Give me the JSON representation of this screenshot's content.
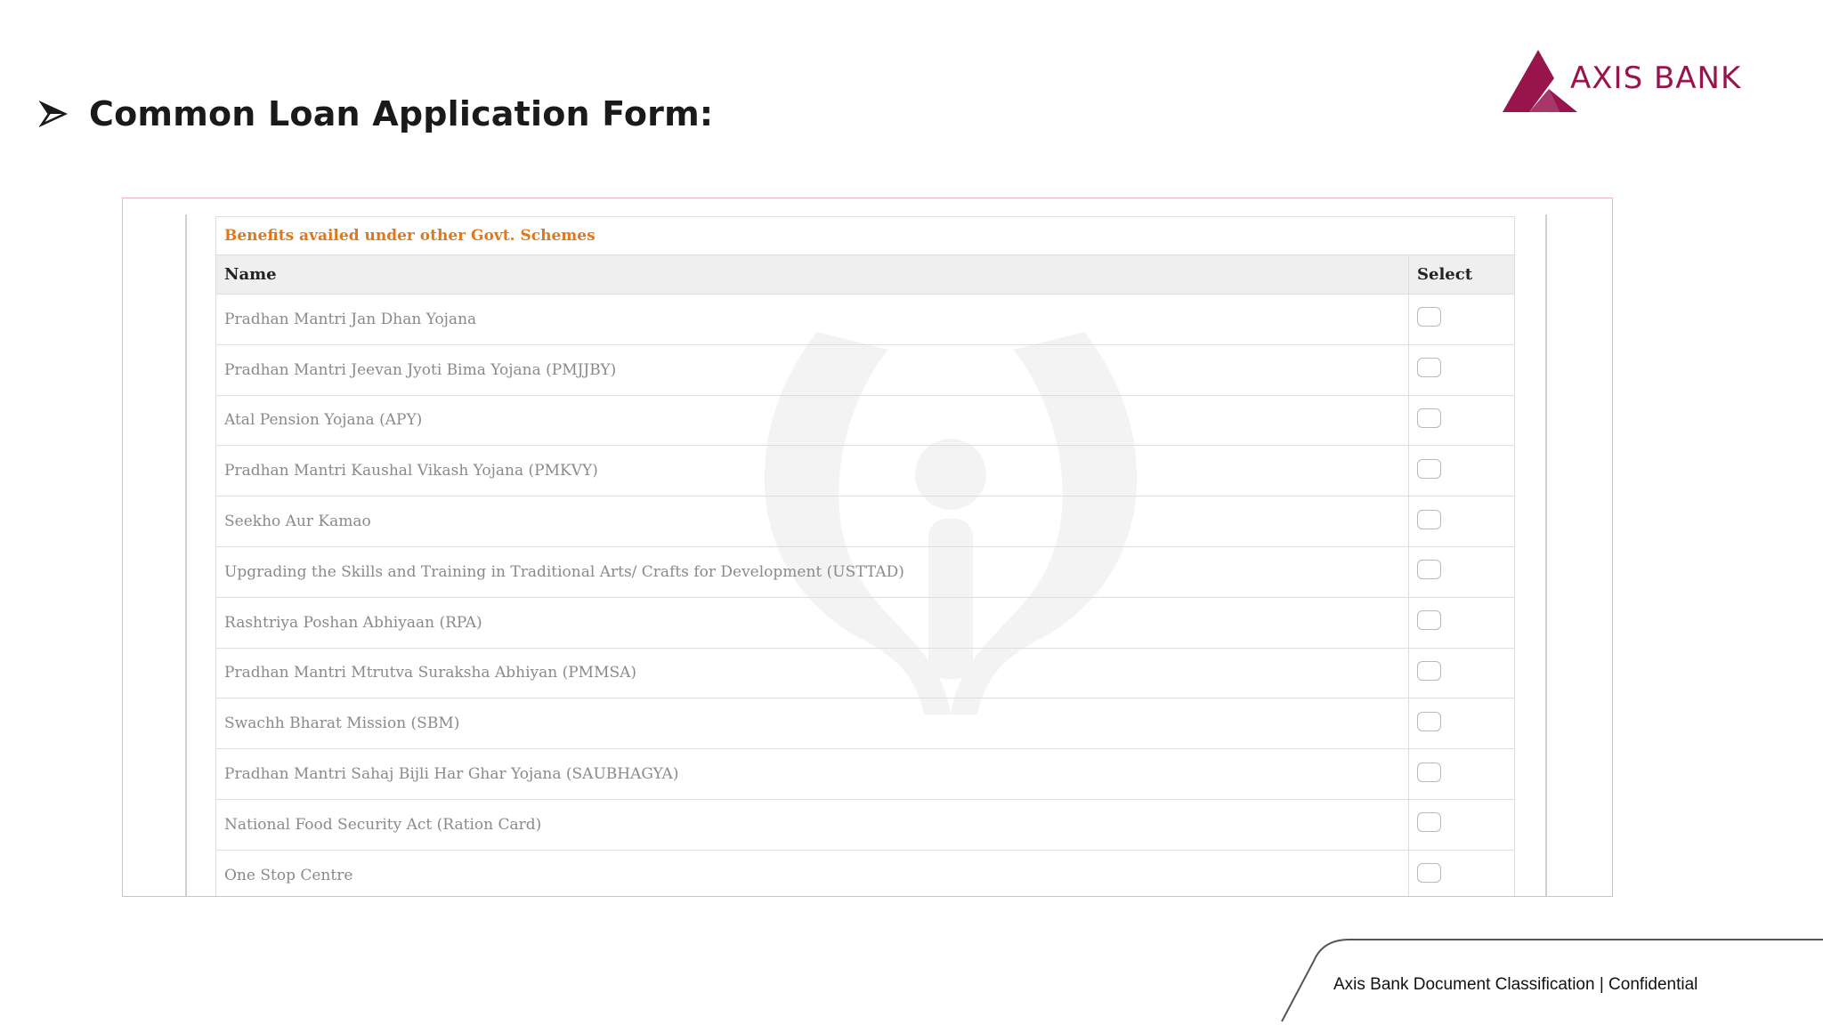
{
  "slide": {
    "heading": "Common Loan Application Form:",
    "bullet_icon": "arrow-bullet-icon",
    "logo": {
      "text": "AXIS BANK",
      "icon": "axis-bank-logo-icon",
      "color": "#97144d"
    },
    "footer": "Axis Bank Document Classification | Confidential"
  },
  "form": {
    "section_title": "Benefits availed under other Govt. Schemes",
    "section_title_color": "#e0781a",
    "columns": [
      "Name",
      "Select"
    ],
    "rows": [
      {
        "name": "Pradhan Mantri Jan Dhan Yojana",
        "selected": false
      },
      {
        "name": "Pradhan Mantri Jeevan Jyoti Bima Yojana (PMJJBY)",
        "selected": false
      },
      {
        "name": "Atal Pension Yojana (APY)",
        "selected": false
      },
      {
        "name": "Pradhan Mantri Kaushal Vikash Yojana (PMKVY)",
        "selected": false
      },
      {
        "name": "Seekho Aur Kamao",
        "selected": false
      },
      {
        "name": "Upgrading the Skills and Training in Traditional Arts/ Crafts for Development (USTTAD)",
        "selected": false
      },
      {
        "name": "Rashtriya Poshan Abhiyaan (RPA)",
        "selected": false
      },
      {
        "name": "Pradhan Mantri Mtrutva Suraksha Abhiyan (PMMSA)",
        "selected": false
      },
      {
        "name": "Swachh Bharat Mission (SBM)",
        "selected": false
      },
      {
        "name": "Pradhan Mantri Sahaj Bijli Har Ghar Yojana (SAUBHAGYA)",
        "selected": false
      },
      {
        "name": "National Food Security Act (Ration Card)",
        "selected": false
      },
      {
        "name": "One Stop Centre",
        "selected": false
      }
    ]
  }
}
